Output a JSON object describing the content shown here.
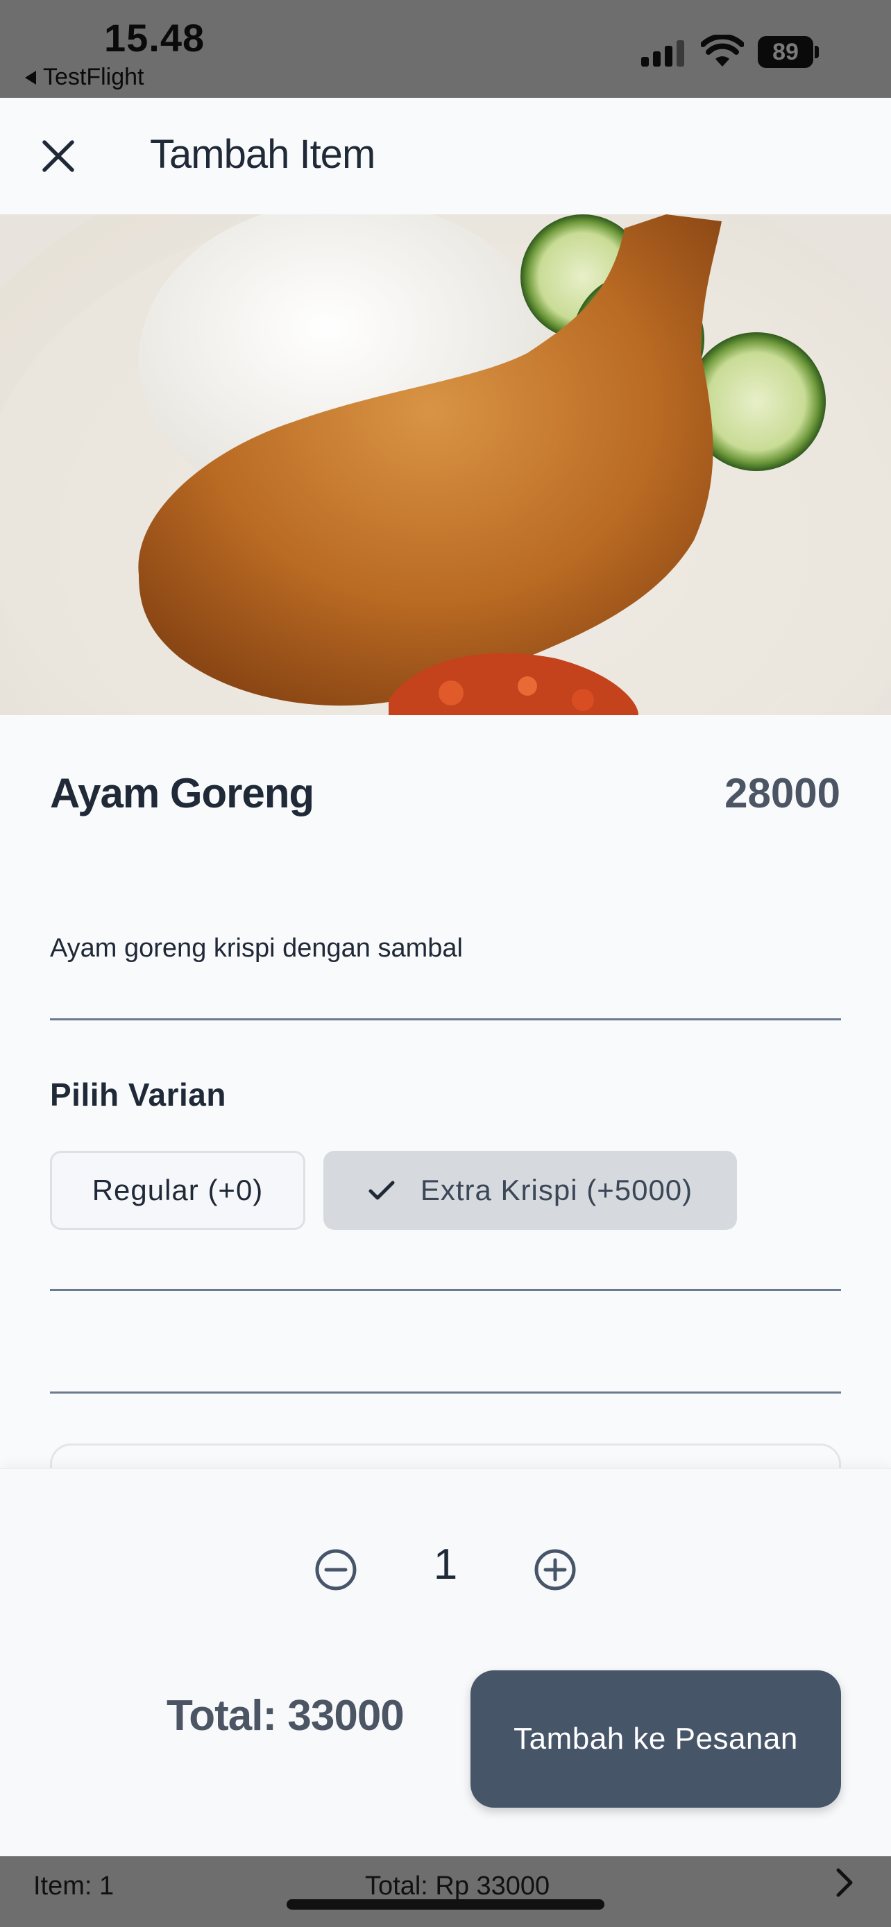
{
  "status_bar": {
    "time": "15.48",
    "back_app": "TestFlight",
    "battery_level": "89",
    "icons": [
      "signal-icon",
      "wifi-icon",
      "battery-icon"
    ]
  },
  "header": {
    "close_icon": "close-icon",
    "title": "Tambah Item"
  },
  "item": {
    "image": "fried-chicken-with-rice-photo",
    "name": "Ayam Goreng",
    "price": "28000",
    "description": "Ayam goreng krispi dengan sambal"
  },
  "variants": {
    "title": "Pilih Varian",
    "options": [
      {
        "label": "Regular (+0)",
        "selected": false
      },
      {
        "label": "Extra Krispi (+5000)",
        "selected": true
      }
    ]
  },
  "quantity": {
    "value": "1",
    "decrease_icon": "minus-circle-icon",
    "increase_icon": "plus-circle-icon"
  },
  "footer": {
    "total": "Total: 33000",
    "add_button": "Tambah ke Pesanan"
  },
  "cart_bar": {
    "items": "Item: 1",
    "total": "Total: Rp 33000",
    "chevron_icon": "chevron-right-icon"
  },
  "colors": {
    "background": "#f9fafb",
    "text_primary": "#1f2937",
    "accent_button": "#475569",
    "chip_selected": "#d6dadf",
    "divider": "#6b7a90"
  }
}
